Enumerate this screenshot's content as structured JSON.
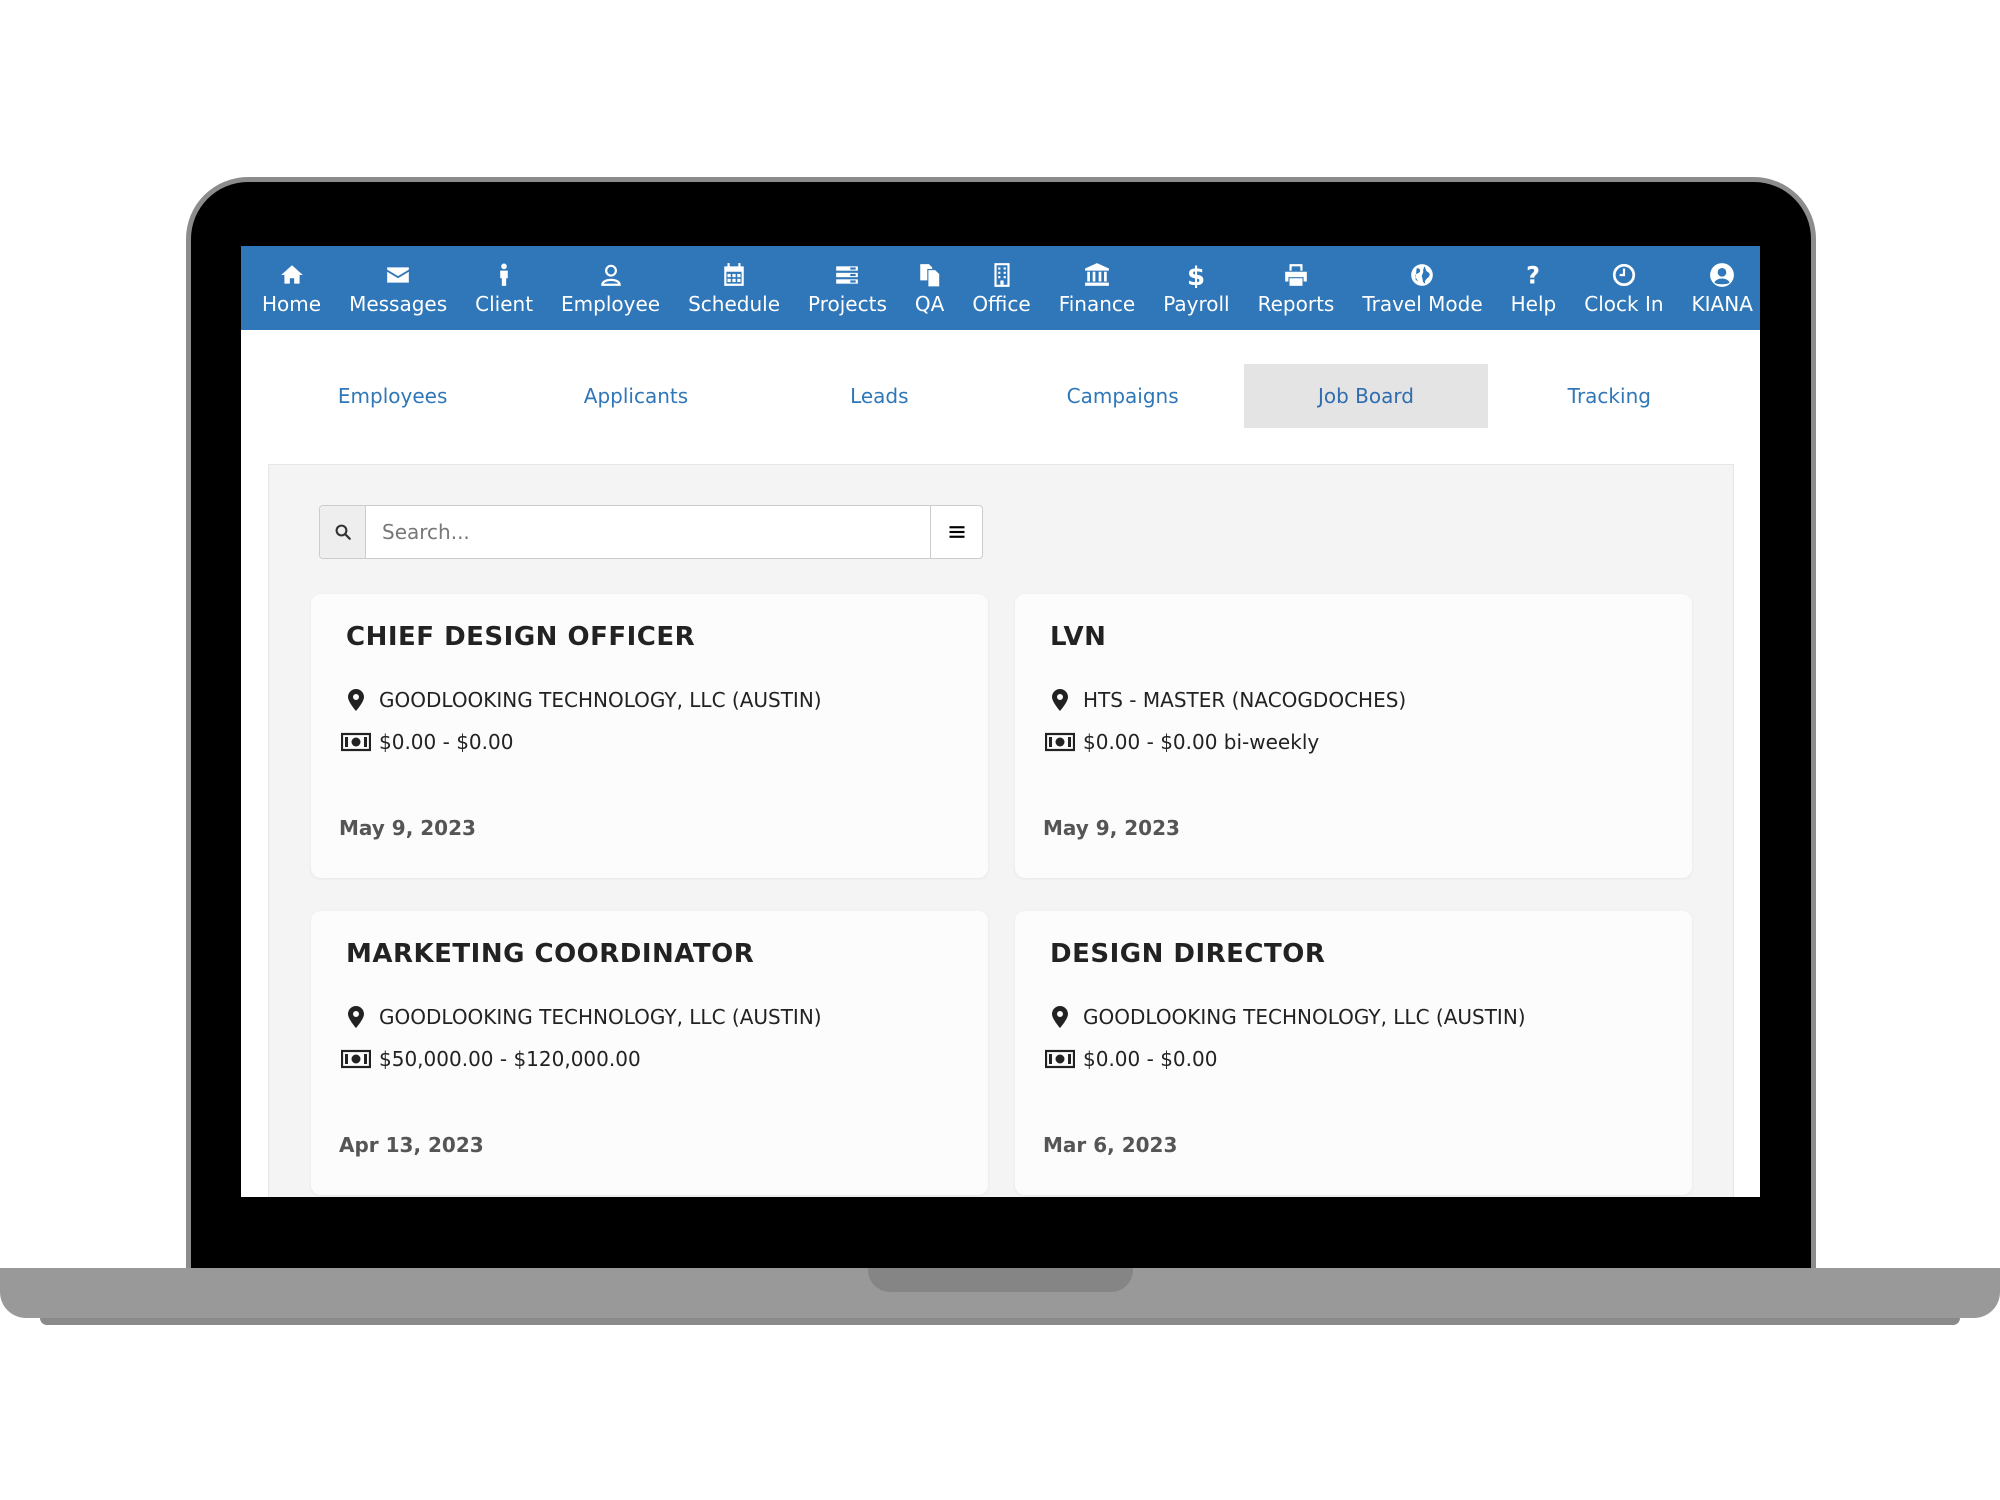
{
  "nav": {
    "items": [
      {
        "label": "Home",
        "icon": "home-icon"
      },
      {
        "label": "Messages",
        "icon": "envelope-icon"
      },
      {
        "label": "Client",
        "icon": "person-icon"
      },
      {
        "label": "Employee",
        "icon": "user-outline-icon"
      },
      {
        "label": "Schedule",
        "icon": "calendar-icon"
      },
      {
        "label": "Projects",
        "icon": "list-icon"
      },
      {
        "label": "QA",
        "icon": "documents-icon"
      },
      {
        "label": "Office",
        "icon": "building-icon"
      },
      {
        "label": "Finance",
        "icon": "bank-icon"
      },
      {
        "label": "Payroll",
        "icon": "dollar-icon"
      },
      {
        "label": "Reports",
        "icon": "printer-icon"
      },
      {
        "label": "Travel Mode",
        "icon": "globe-icon"
      },
      {
        "label": "Help",
        "icon": "question-icon"
      },
      {
        "label": "Clock In",
        "icon": "clock-icon"
      },
      {
        "label": "KIANA",
        "icon": "user-circle-icon"
      }
    ]
  },
  "subtabs": {
    "items": [
      "Employees",
      "Applicants",
      "Leads",
      "Campaigns",
      "Job Board",
      "Tracking"
    ],
    "active": "Job Board"
  },
  "search": {
    "placeholder": "Search..."
  },
  "jobs": [
    {
      "title": "CHIEF DESIGN OFFICER",
      "location": "GOODLOOKING TECHNOLOGY, LLC (AUSTIN)",
      "pay": "$0.00 - $0.00",
      "date": "May 9, 2023"
    },
    {
      "title": "LVN",
      "location": "HTS - MASTER (NACOGDOCHES)",
      "pay": "$0.00 - $0.00 bi-weekly",
      "date": "May 9, 2023"
    },
    {
      "title": "MARKETING COORDINATOR",
      "location": "GOODLOOKING TECHNOLOGY, LLC (AUSTIN)",
      "pay": "$50,000.00 - $120,000.00",
      "date": "Apr 13, 2023"
    },
    {
      "title": "DESIGN DIRECTOR",
      "location": "GOODLOOKING TECHNOLOGY, LLC (AUSTIN)",
      "pay": "$0.00 - $0.00",
      "date": "Mar 6, 2023"
    }
  ],
  "colors": {
    "nav_bg": "#2f77b8",
    "link": "#2f77b8",
    "active_tab_bg": "#e4e4e4",
    "panel_bg": "#f4f4f4"
  }
}
